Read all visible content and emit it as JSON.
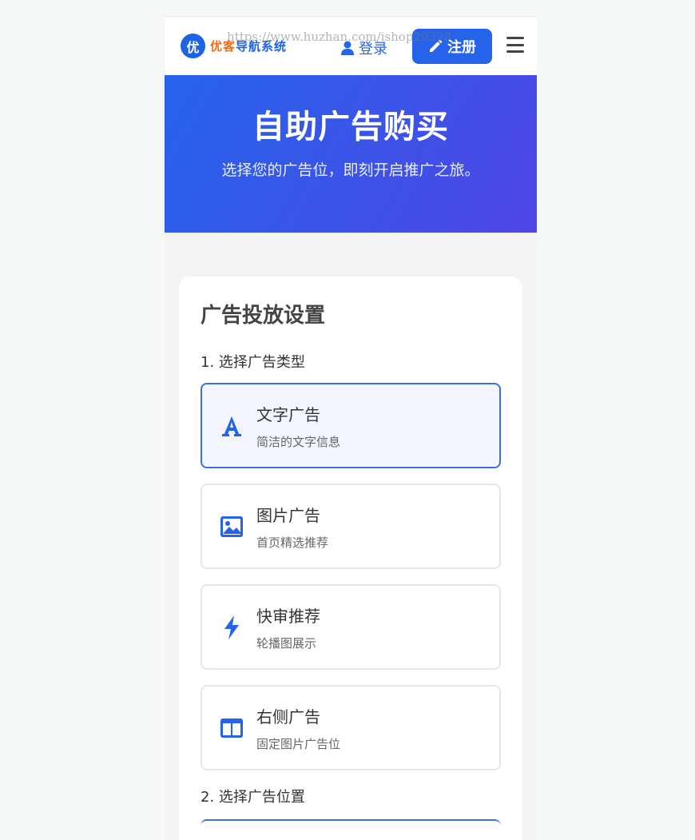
{
  "header": {
    "logo_badge": "优",
    "logo_text_a": "优客",
    "logo_text_b": "导航系统",
    "login_label": "登录",
    "register_label": "注册",
    "watermark": "https://www.huzhan.com/ishop20328"
  },
  "hero": {
    "title": "自助广告购买",
    "subtitle": "选择您的广告位，即刻开启推广之旅。"
  },
  "card": {
    "title": "广告投放设置",
    "step1_label": "1. 选择广告类型",
    "step2_label": "2. 选择广告位置",
    "options": [
      {
        "title": "文字广告",
        "desc": "简洁的文字信息",
        "icon": "text-icon",
        "selected": true
      },
      {
        "title": "图片广告",
        "desc": "首页精选推荐",
        "icon": "image-icon",
        "selected": false
      },
      {
        "title": "快审推荐",
        "desc": "轮播图展示",
        "icon": "lightning-icon",
        "selected": false
      },
      {
        "title": "右侧广告",
        "desc": "固定图片广告位",
        "icon": "layout-columns-icon",
        "selected": false
      }
    ]
  },
  "colors": {
    "primary": "#2563eb",
    "hero_end": "#4f46e5",
    "selected_border": "#3b6fdc"
  }
}
